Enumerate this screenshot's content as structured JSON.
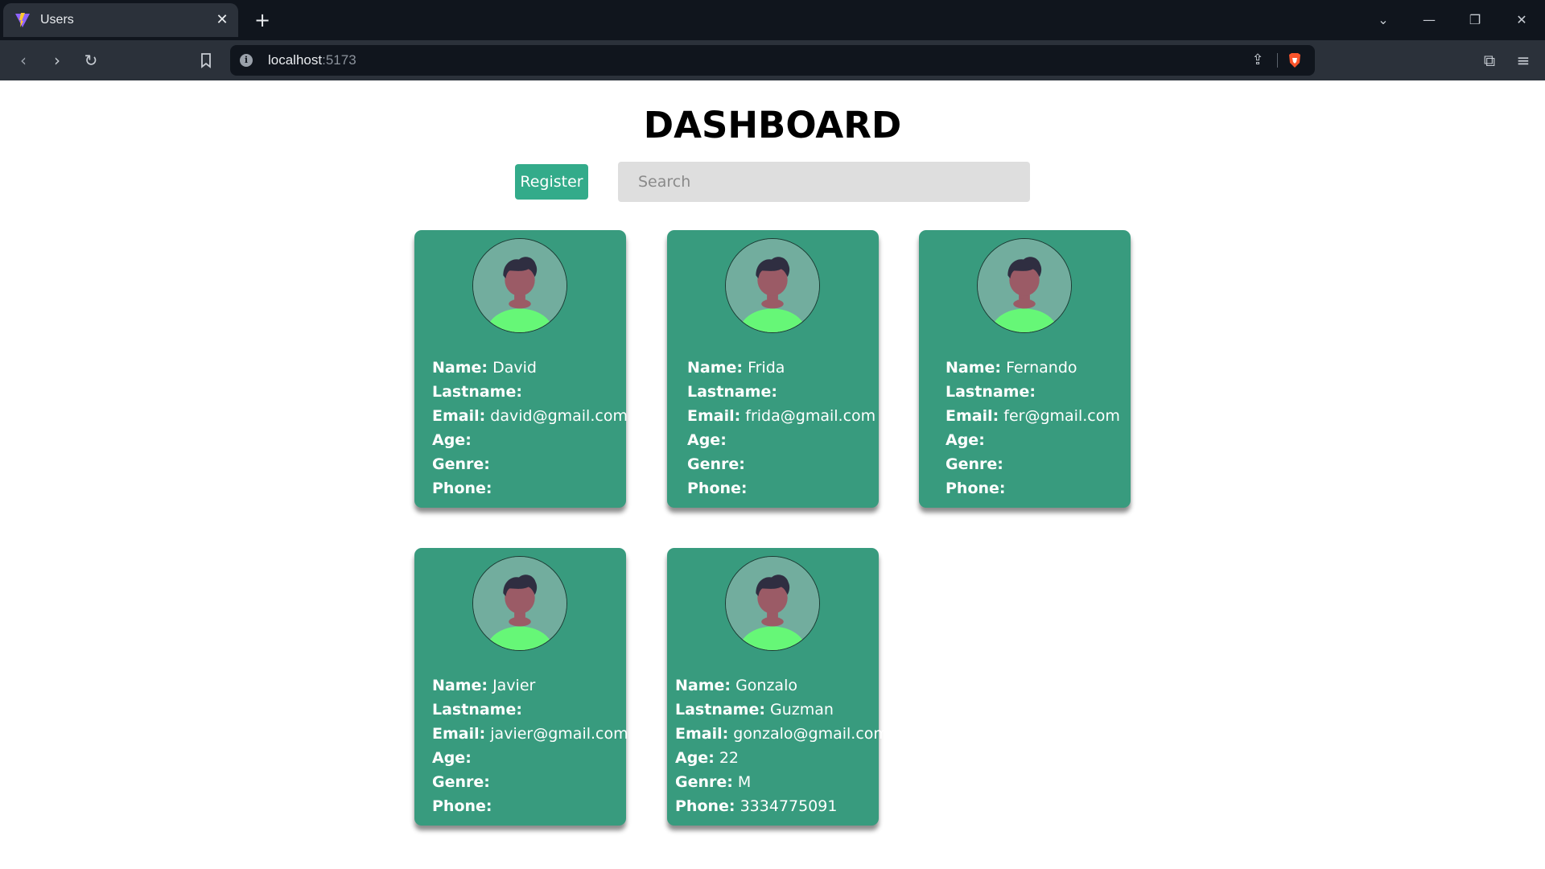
{
  "browser": {
    "tab_title": "Users",
    "url_host": "localhost",
    "url_port": ":5173"
  },
  "page": {
    "heading": "DASHBOARD",
    "register_label": "Register",
    "search_placeholder": "Search",
    "colors": {
      "card": "#389b7e",
      "button": "#33ab8a",
      "search_bg": "#dedede"
    }
  },
  "labels": {
    "name": "Name:",
    "lastname": "Lastname:",
    "email": "Email:",
    "age": "Age:",
    "genre": "Genre:",
    "phone": "Phone:"
  },
  "users": [
    {
      "name": "David",
      "lastname": "",
      "email": "david@gmail.com",
      "age": "",
      "genre": "",
      "phone": ""
    },
    {
      "name": "Frida",
      "lastname": "",
      "email": "frida@gmail.com",
      "age": "",
      "genre": "",
      "phone": ""
    },
    {
      "name": "Fernando",
      "lastname": "",
      "email": "fer@gmail.com",
      "age": "",
      "genre": "",
      "phone": ""
    },
    {
      "name": "Javier",
      "lastname": "",
      "email": "javier@gmail.com",
      "age": "",
      "genre": "",
      "phone": ""
    },
    {
      "name": "Gonzalo",
      "lastname": "Guzman",
      "email": "gonzalo@gmail.com",
      "age": "22",
      "genre": "M",
      "phone": "3334775091"
    }
  ]
}
